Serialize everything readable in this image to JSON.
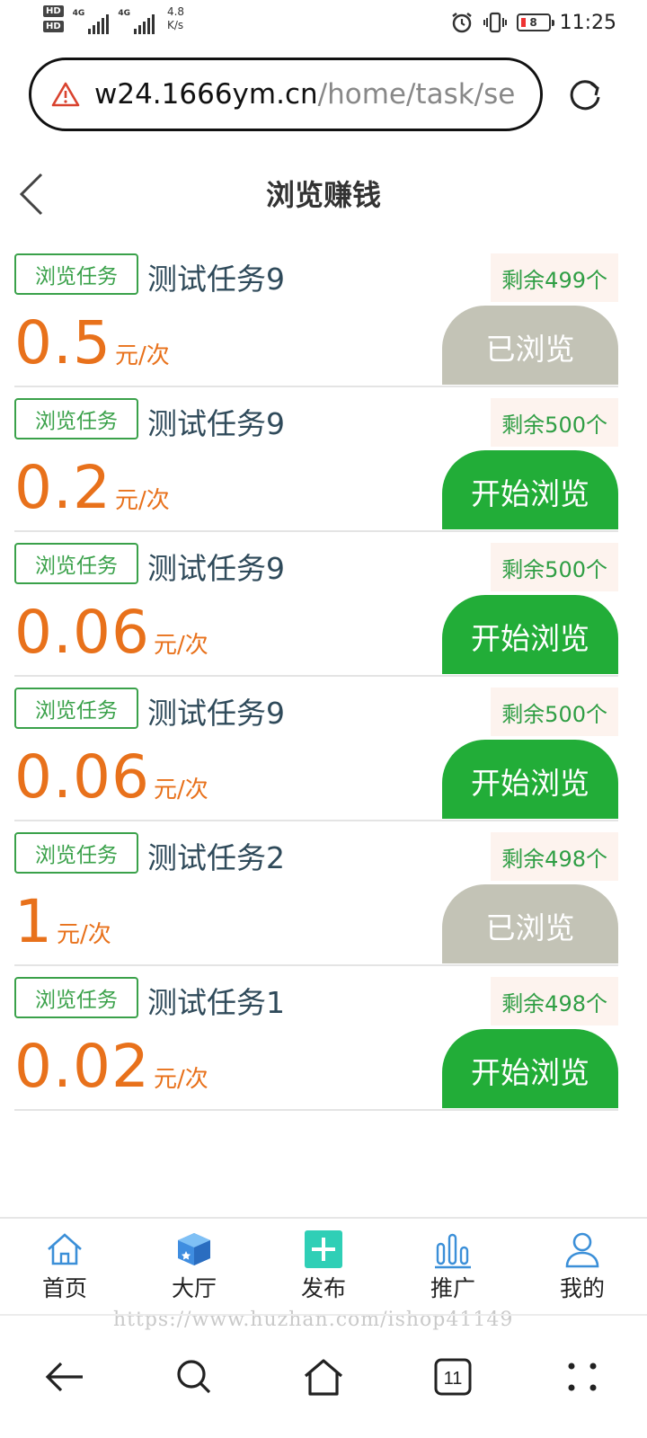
{
  "status_bar": {
    "hd1": "HD",
    "hd2": "HD",
    "network1": "4G",
    "network2": "4G",
    "speed_value": "4.8",
    "speed_unit": "K/s",
    "battery": "8",
    "time": "11:25"
  },
  "browser": {
    "url_host": "w24.1666ym.cn",
    "url_path": "/home/task/se",
    "warning_icon": "warning-triangle-icon",
    "reload_icon": "reload-icon"
  },
  "header": {
    "title": "浏览赚钱",
    "back_icon": "chevron-left-icon"
  },
  "tasks": [
    {
      "tag": "浏览任务",
      "name": "测试任务9",
      "remain": "剩余499个",
      "amount": "0.5",
      "unit": "元/次",
      "button": "已浏览",
      "state": "done"
    },
    {
      "tag": "浏览任务",
      "name": "测试任务9",
      "remain": "剩余500个",
      "amount": "0.2",
      "unit": "元/次",
      "button": "开始浏览",
      "state": "start"
    },
    {
      "tag": "浏览任务",
      "name": "测试任务9",
      "remain": "剩余500个",
      "amount": "0.06",
      "unit": "元/次",
      "button": "开始浏览",
      "state": "start"
    },
    {
      "tag": "浏览任务",
      "name": "测试任务9",
      "remain": "剩余500个",
      "amount": "0.06",
      "unit": "元/次",
      "button": "开始浏览",
      "state": "start"
    },
    {
      "tag": "浏览任务",
      "name": "测试任务2",
      "remain": "剩余498个",
      "amount": "1",
      "unit": "元/次",
      "button": "已浏览",
      "state": "done"
    },
    {
      "tag": "浏览任务",
      "name": "测试任务1",
      "remain": "剩余498个",
      "amount": "0.02",
      "unit": "元/次",
      "button": "开始浏览",
      "state": "start"
    }
  ],
  "tabbar": [
    {
      "label": "首页",
      "icon": "home-icon"
    },
    {
      "label": "大厅",
      "icon": "cube-icon"
    },
    {
      "label": "发布",
      "icon": "plus-icon"
    },
    {
      "label": "推广",
      "icon": "bar-chart-icon"
    },
    {
      "label": "我的",
      "icon": "user-icon"
    }
  ],
  "watermark": "https://www.huzhan.com/ishop41149",
  "system_nav": {
    "tab_count": "11"
  },
  "colors": {
    "green": "#22ad38",
    "orange": "#e8711b",
    "gray_button": "#c3c3b6"
  }
}
